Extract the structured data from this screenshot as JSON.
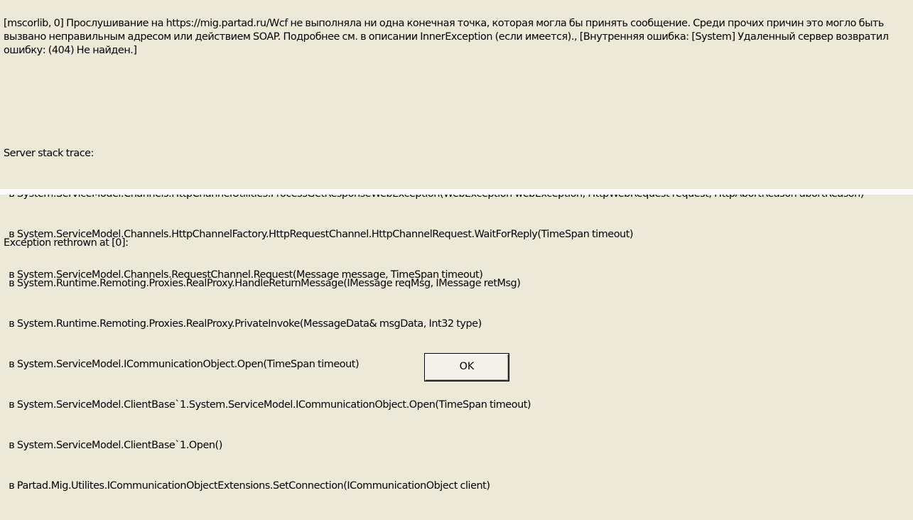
{
  "message": {
    "main": "[mscorlib, 0] Прослушивание на https://mig.partad.ru/Wcf не выполняла ни одна конечная точка, которая могла бы принять сообщение. Среди прочих причин это могло быть вызвано неправильным адресом или действием SOAP. Подробнее см. в описании InnerException (если имеется)., [Внутренняя ошибка: [System] Удаленный сервер возвратил ошибку: (404) Не найден.]"
  },
  "server_stack_trace": {
    "heading": "Server stack trace:",
    "lines": [
      "  в System.ServiceModel.Channels.HttpChannelUtilities.ProcessGetResponseWebException(WebException webException, HttpWebRequest request, HttpAbortReason abortReason)",
      "  в System.ServiceModel.Channels.HttpChannelFactory.HttpRequestChannel.HttpChannelRequest.WaitForReply(TimeSpan timeout)",
      "  в System.ServiceModel.Channels.RequestChannel.Request(Message message, TimeSpan timeout)"
    ]
  },
  "exception_rethrown": {
    "heading": "Exception rethrown at [0]:",
    "lines": [
      "  в System.Runtime.Remoting.Proxies.RealProxy.HandleReturnMessage(IMessage reqMsg, IMessage retMsg)",
      "  в System.Runtime.Remoting.Proxies.RealProxy.PrivateInvoke(MessageData& msgData, Int32 type)",
      "  в System.ServiceModel.ICommunicationObject.Open(TimeSpan timeout)",
      "  в System.ServiceModel.ClientBase`1.System.ServiceModel.ICommunicationObject.Open(TimeSpan timeout)",
      "  в System.ServiceModel.ClientBase`1.Open()",
      "  в Partad.Mig.Utilites.ICommunicationObjectExtensions.SetConnection(ICommunicationObject client)"
    ]
  },
  "buttons": {
    "ok_label": "OK"
  },
  "colors": {
    "dialog_background": "#ECE9D8",
    "separator": "#FFFFFF",
    "text": "#000000"
  }
}
